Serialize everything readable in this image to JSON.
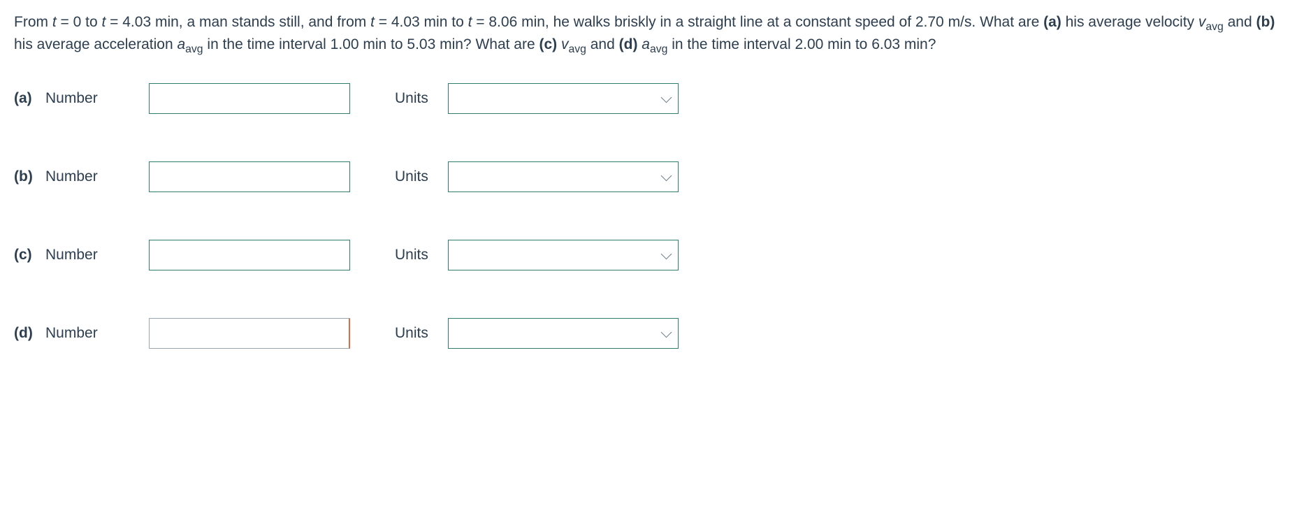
{
  "problem": {
    "seg1": "From ",
    "t": "t",
    "seg2": " = 0 to ",
    "seg3": " = 4.03 min, a man stands still, and from ",
    "seg4": " = 4.03 min to ",
    "seg5": " = 8.06 min, he walks briskly in a straight line at a constant speed of 2.70 m/s. What are ",
    "pa": "(a)",
    "seg6": " his average velocity ",
    "v": "v",
    "avg": "avg",
    "seg7": " and ",
    "pb": "(b)",
    "seg8": " his average acceleration ",
    "a": "a",
    "seg9": " in the time interval 1.00 min to 5.03 min? What are ",
    "pc": "(c)",
    "sp": " ",
    "pd": "(d)",
    "seg10": " in the time interval 2.00 min to 6.03 min?"
  },
  "rows": {
    "a": {
      "part": "(a)",
      "numLabel": "Number",
      "unitsLabel": "Units",
      "value": "",
      "unitsValue": ""
    },
    "b": {
      "part": "(b)",
      "numLabel": "Number",
      "unitsLabel": "Units",
      "value": "",
      "unitsValue": ""
    },
    "c": {
      "part": "(c)",
      "numLabel": "Number",
      "unitsLabel": "Units",
      "value": "",
      "unitsValue": ""
    },
    "d": {
      "part": "(d)",
      "numLabel": "Number",
      "unitsLabel": "Units",
      "value": "",
      "unitsValue": ""
    }
  }
}
